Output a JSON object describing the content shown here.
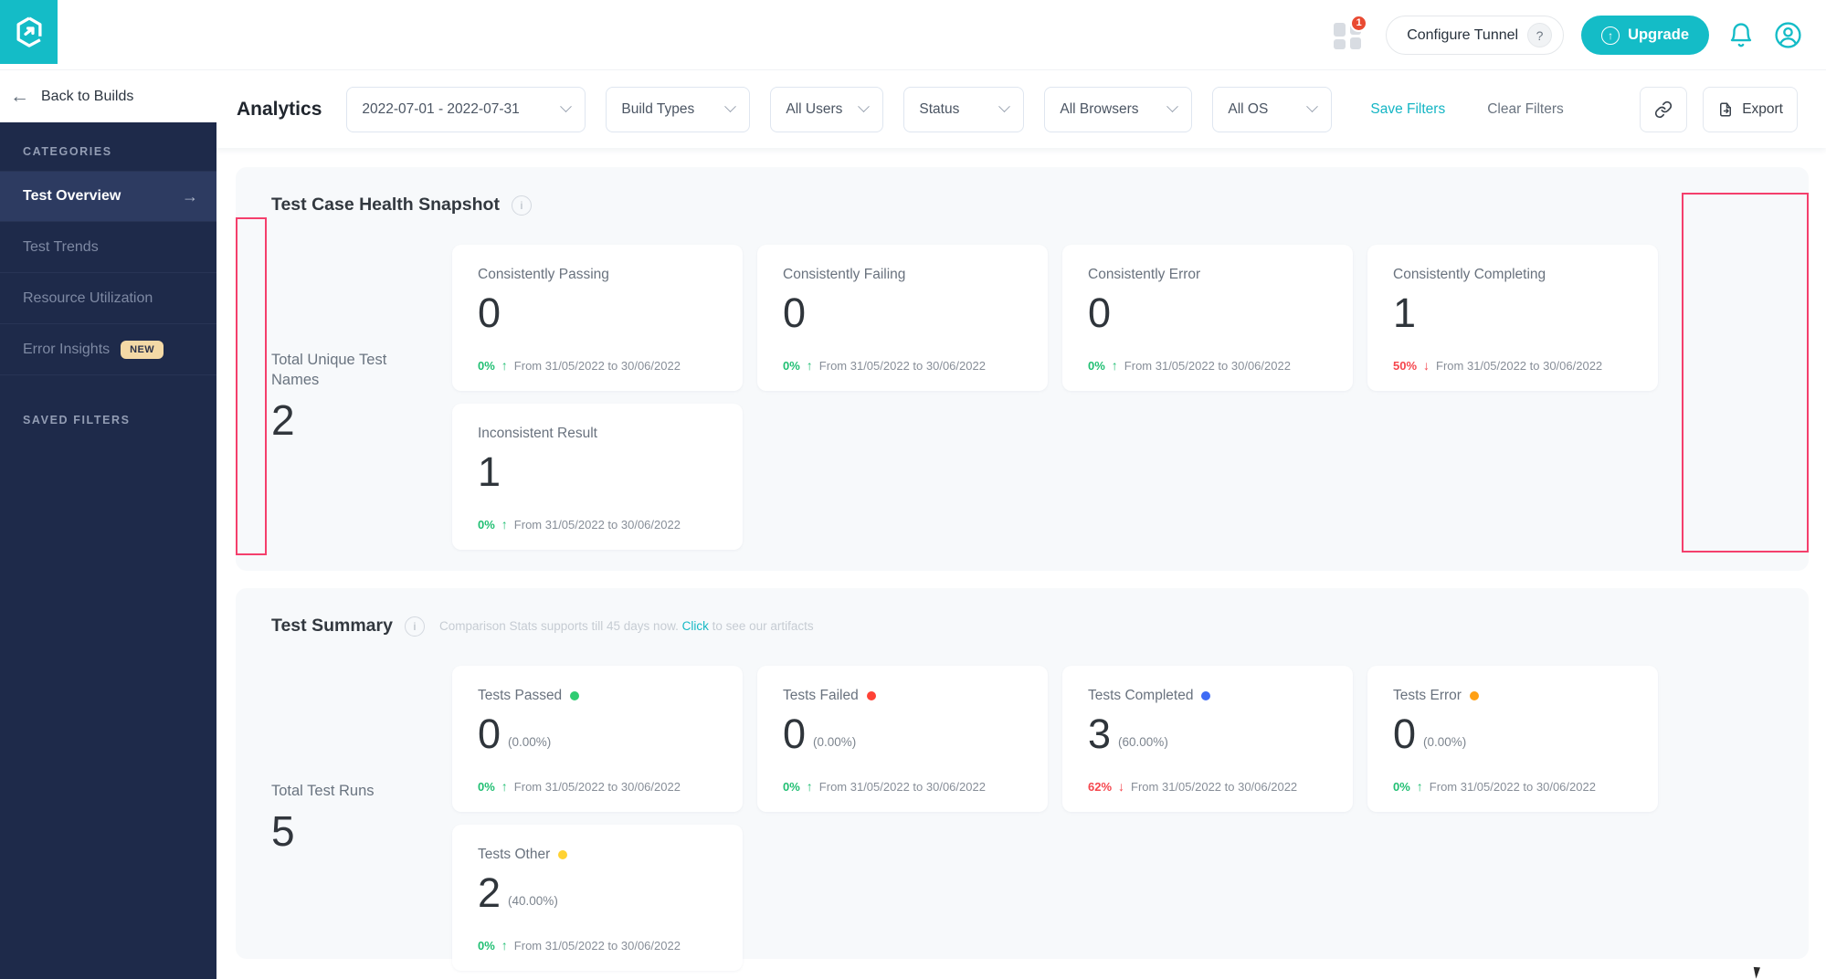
{
  "topbar": {
    "apps_badge_count": "1",
    "configure_tunnel_label": "Configure Tunnel",
    "help_label": "?",
    "upgrade_label": "Upgrade"
  },
  "back_link": {
    "label": "Back to Builds"
  },
  "sidebar": {
    "categories_title": "CATEGORIES",
    "items": [
      {
        "label": "Test Overview",
        "active": true
      },
      {
        "label": "Test Trends",
        "active": false
      },
      {
        "label": "Resource Utilization",
        "active": false
      },
      {
        "label": "Error Insights",
        "active": false,
        "badge": "NEW"
      }
    ],
    "saved_filters_title": "SAVED FILTERS"
  },
  "filters": {
    "page_title": "Analytics",
    "dropdowns": [
      {
        "name": "date-range",
        "label": "2022-07-01 - 2022-07-31"
      },
      {
        "name": "build-types",
        "label": "Build Types"
      },
      {
        "name": "all-users",
        "label": "All Users"
      },
      {
        "name": "status",
        "label": "Status"
      },
      {
        "name": "all-browsers",
        "label": "All Browsers"
      },
      {
        "name": "all-os",
        "label": "All OS"
      }
    ],
    "save_filters_label": "Save Filters",
    "clear_filters_label": "Clear Filters",
    "export_label": "Export"
  },
  "snapshot": {
    "title": "Test Case Health Snapshot",
    "total_label": "Total Unique Test Names",
    "total_value": "2",
    "cards": [
      {
        "label": "Consistently Passing",
        "value": "0",
        "change": "0%",
        "direction": "up",
        "period": "From 31/05/2022 to 30/06/2022"
      },
      {
        "label": "Consistently Failing",
        "value": "0",
        "change": "0%",
        "direction": "up",
        "period": "From 31/05/2022 to 30/06/2022"
      },
      {
        "label": "Consistently Error",
        "value": "0",
        "change": "0%",
        "direction": "up",
        "period": "From 31/05/2022 to 30/06/2022"
      },
      {
        "label": "Consistently Completing",
        "value": "1",
        "change": "50%",
        "direction": "down",
        "period": "From 31/05/2022 to 30/06/2022"
      },
      {
        "label": "Inconsistent Result",
        "value": "1",
        "change": "0%",
        "direction": "up",
        "period": "From 31/05/2022 to 30/06/2022"
      }
    ]
  },
  "summary": {
    "title": "Test Summary",
    "note": {
      "prefix": "Comparison Stats supports till 45 days now.",
      "link": "Click",
      "suffix": "to see our artifacts"
    },
    "total_label": "Total Test Runs",
    "total_value": "5",
    "cards": [
      {
        "label": "Tests Passed",
        "dot_color": "#2ECC71",
        "value": "0",
        "pct": "(0.00%)",
        "change": "0%",
        "direction": "up",
        "period": "From 31/05/2022 to 30/06/2022"
      },
      {
        "label": "Tests Failed",
        "dot_color": "#FF4236",
        "value": "0",
        "pct": "(0.00%)",
        "change": "0%",
        "direction": "up",
        "period": "From 31/05/2022 to 30/06/2022"
      },
      {
        "label": "Tests Completed",
        "dot_color": "#3E6BF5",
        "value": "3",
        "pct": "(60.00%)",
        "change": "62%",
        "direction": "down",
        "period": "From 31/05/2022 to 30/06/2022"
      },
      {
        "label": "Tests Error",
        "dot_color": "#FFA014",
        "value": "0",
        "pct": "(0.00%)",
        "change": "0%",
        "direction": "up",
        "period": "From 31/05/2022 to 30/06/2022"
      },
      {
        "label": "Tests Other",
        "dot_color": "#FFD232",
        "value": "2",
        "pct": "(40.00%)",
        "change": "0%",
        "direction": "up",
        "period": "From 31/05/2022 to 30/06/2022"
      }
    ]
  },
  "colors": {
    "brand_teal": "#14BCC7",
    "sidebar_navy": "#1E2A4A",
    "trend_up": "#21BF73",
    "trend_down": "#F5464D",
    "annotation_pink": "#F43F6C",
    "notification_red": "#E94A32",
    "new_badge_bg": "#F4D9A6"
  }
}
